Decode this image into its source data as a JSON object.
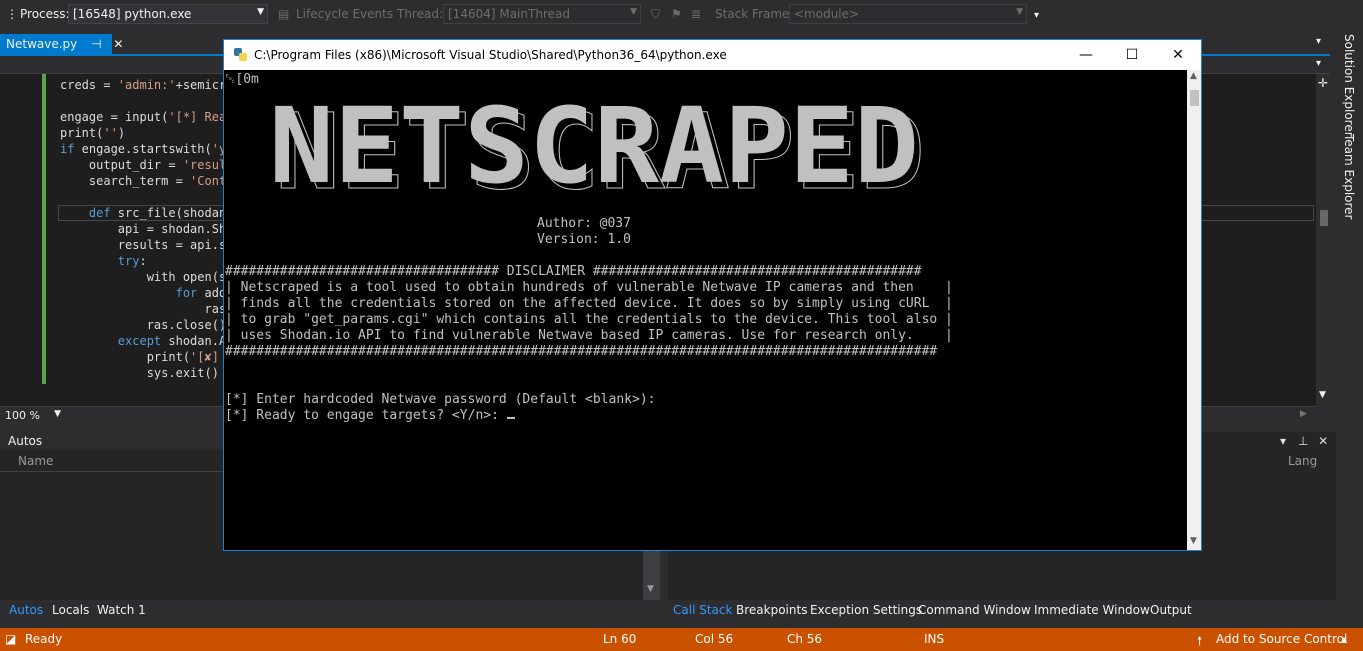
{
  "toolbar": {
    "process_label": "Process:",
    "process_value": "[16548] python.exe",
    "lifecycle_label": "Lifecycle Events",
    "thread_label": "Thread:",
    "thread_value": "[14604] MainThread",
    "stackframe_label": "Stack Frame:",
    "stackframe_value": "<module>"
  },
  "doc_tab": {
    "title": "Netwave.py",
    "pin": "⊣",
    "close": "✕"
  },
  "editor": {
    "lines": [
      [
        "creds = ",
        "'admin:'",
        "+semicr"
      ],
      [
        "engage = input(",
        "'[*] Rea",
        ""
      ],
      [
        "print(",
        "''",
        ")"
      ],
      [
        "if",
        " engage.startswith(",
        "'y"
      ],
      [
        "    output_dir = ",
        "'resul",
        ""
      ],
      [
        "    search_term = ",
        "'Cont",
        ""
      ],
      [
        "    def",
        " src_file(shodan_",
        ""
      ],
      [
        "        api = shodan.Sho",
        "",
        ""
      ],
      [
        "        results = api.se",
        "",
        ""
      ],
      [
        "        try",
        ":",
        ""
      ],
      [
        "            with open(s",
        "",
        ""
      ],
      [
        "                for",
        " add",
        ""
      ],
      [
        "                    ras",
        "",
        ""
      ],
      [
        "            ras.close()",
        "",
        ""
      ],
      [
        "        except",
        " shodan.A",
        ""
      ],
      [
        "            print(",
        "'[✘]",
        ""
      ],
      [
        "            sys.exit()",
        "",
        ""
      ]
    ],
    "zoom": "100 %"
  },
  "autos": {
    "title": "Autos",
    "column_name": "Name",
    "column_lang": "Lang"
  },
  "bottom_tabs_left": [
    "Autos",
    "Locals",
    "Watch 1"
  ],
  "bottom_tabs_right": [
    "Call Stack",
    "Breakpoints",
    "Exception Settings",
    "Command Window",
    "Immediate Window",
    "Output"
  ],
  "side_tabs": [
    "Solution Explorer",
    "Team Explorer"
  ],
  "statusbar": {
    "ready": "Ready",
    "ln": "Ln 60",
    "col": "Col 56",
    "ch": "Ch 56",
    "ins": "INS",
    "source_control": "Add to Source Control"
  },
  "console": {
    "title": "C:\\Program Files (x86)\\Microsoft Visual Studio\\Shared\\Python36_64\\python.exe",
    "escape": "␛[0m",
    "banner": "NETSCRAPED",
    "author": "Author: @037",
    "version": "Version: 1.0",
    "disclaimer_header": "################################### DISCLAIMER ##########################################",
    "disclaimer_lines": [
      "| Netscraped is a tool used to obtain hundreds of vulnerable Netwave IP cameras and then    |",
      "| finds all the credentials stored on the affected device. It does so by simply using cURL  |",
      "| to grab \"get_params.cgi\" which contains all the credentials to the device. This tool also |",
      "| uses Shodan.io API to find vulnerable Netwave based IP cameras. Use for research only.    |"
    ],
    "disclaimer_footer": "###########################################################################################",
    "prompt1": "[*] Enter hardcoded Netwave password (Default <blank>):",
    "prompt2": "[*] Ready to engage targets? <Y/n>: "
  },
  "colors": {
    "accent": "#007acc",
    "statusbar": "#ca5100",
    "editor_bg": "#1e1e1e",
    "console_bg": "#000000"
  }
}
